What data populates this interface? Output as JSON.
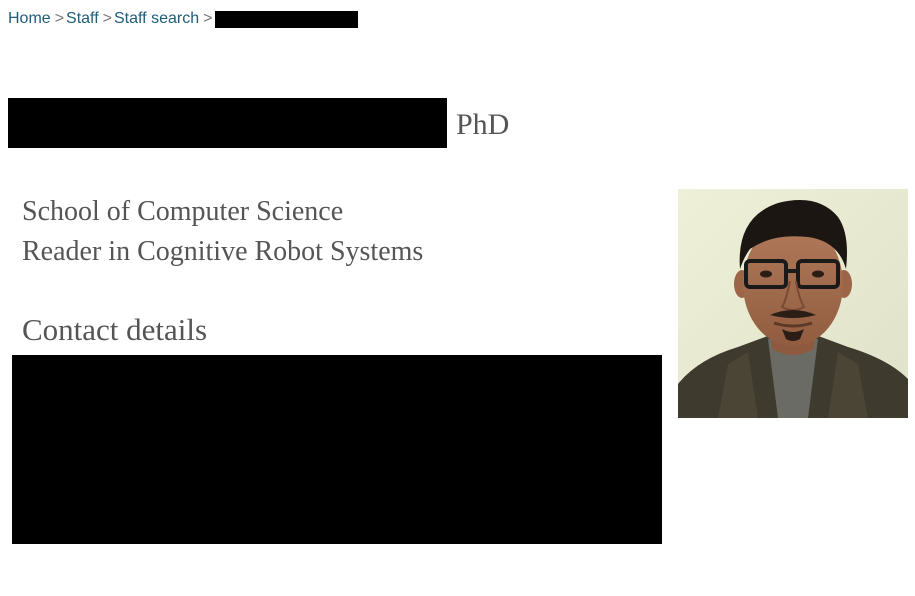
{
  "breadcrumb": {
    "items": [
      "Home",
      "Staff",
      "Staff search"
    ],
    "separator": ">"
  },
  "profile": {
    "name_suffix": "PhD",
    "school": "School of Computer Science",
    "position": "Reader in Cognitive Robot Systems"
  },
  "contact": {
    "heading": "Contact details"
  },
  "colors": {
    "link": "#1f5c77",
    "text": "#555555",
    "redaction": "#000000"
  }
}
